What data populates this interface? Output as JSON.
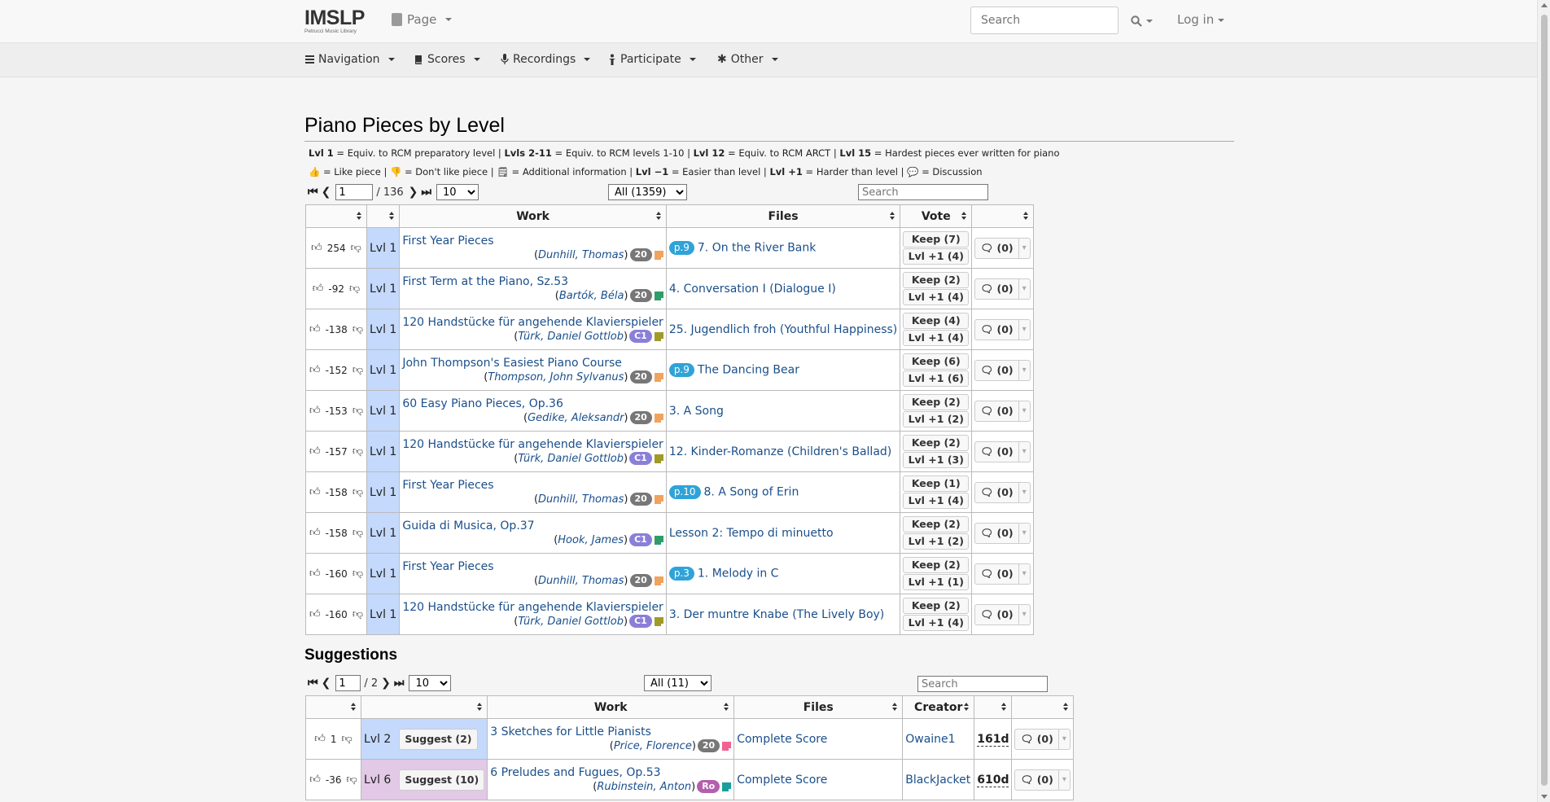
{
  "header": {
    "logo": "IMSLP",
    "logo_sub": "Petrucci Music Library",
    "page_menu": "Page",
    "search_placeholder": "Search",
    "login": "Log in"
  },
  "nav": [
    "Navigation",
    "Scores",
    "Recordings",
    "Participate",
    "Other"
  ],
  "title": "Piano Pieces by Level",
  "legend1": [
    {
      "b": "Lvl 1",
      "t": " = Equiv. to RCM preparatory level | "
    },
    {
      "b": "Lvls 2-11",
      "t": " = Equiv. to RCM levels 1-10 | "
    },
    {
      "b": "Lvl 12",
      "t": " = Equiv. to RCM ARCT | "
    },
    {
      "b": "Lvl 15",
      "t": " = Hardest pieces ever written for piano"
    }
  ],
  "legend2": [
    {
      "b": "",
      "t": "👍 = Like piece | 👎 = Don't like piece | 🗒 = Additional information | "
    },
    {
      "b": "Lvl −1",
      "t": " = Easier than level | "
    },
    {
      "b": "Lvl +1",
      "t": " = Harder than level | 💬 = Discussion"
    }
  ],
  "pager": {
    "page": "1",
    "total": "/ 136",
    "per_page": "10",
    "filter": "All (1359)",
    "search_placeholder": "Search"
  },
  "columns": [
    "",
    "",
    "Work",
    "Files",
    "Vote",
    ""
  ],
  "rows": [
    {
      "score": "254",
      "level": "Lvl 1",
      "work": "First Year Pieces",
      "composer": "Dunhill, Thomas",
      "badge": "20",
      "badge_type": "b20",
      "sq": "#f0a35c",
      "pbadge": "p.9",
      "file": "7. On the River Bank",
      "keep": "Keep (7)",
      "lvl": "Lvl +1 (4)",
      "disc": "(0)"
    },
    {
      "score": "-92",
      "level": "Lvl 1",
      "work": "First Term at the Piano, Sz.53",
      "composer": "Bartók, Béla",
      "badge": "20",
      "badge_type": "b20",
      "sq": "#2e9d6a",
      "pbadge": "",
      "file": "4. Conversation I (Dialogue I)",
      "keep": "Keep (2)",
      "lvl": "Lvl +1 (4)",
      "disc": "(0)"
    },
    {
      "score": "-138",
      "level": "Lvl 1",
      "work": "120 Handstücke für angehende Klavierspieler",
      "composer": "Türk, Daniel Gottlob",
      "badge": "C1",
      "badge_type": "bC1",
      "sq": "#a09a2a",
      "pbadge": "",
      "file": "25. Jugendlich froh (Youthful Happiness)",
      "keep": "Keep (4)",
      "lvl": "Lvl +1 (4)",
      "disc": "(0)"
    },
    {
      "score": "-152",
      "level": "Lvl 1",
      "work": "John Thompson's Easiest Piano Course",
      "composer": "Thompson, John Sylvanus",
      "badge": "20",
      "badge_type": "b20",
      "sq": "#f0a35c",
      "pbadge": "p.9",
      "file": "The Dancing Bear",
      "keep": "Keep (6)",
      "lvl": "Lvl +1 (6)",
      "disc": "(0)"
    },
    {
      "score": "-153",
      "level": "Lvl 1",
      "work": "60 Easy Piano Pieces, Op.36",
      "composer": "Gedike, Aleksandr",
      "badge": "20",
      "badge_type": "b20",
      "sq": "#f0a35c",
      "pbadge": "",
      "file": "3. A Song",
      "keep": "Keep (2)",
      "lvl": "Lvl +1 (2)",
      "disc": "(0)"
    },
    {
      "score": "-157",
      "level": "Lvl 1",
      "work": "120 Handstücke für angehende Klavierspieler",
      "composer": "Türk, Daniel Gottlob",
      "badge": "C1",
      "badge_type": "bC1",
      "sq": "#a09a2a",
      "pbadge": "",
      "file": "12. Kinder-Romanze (Children's Ballad)",
      "keep": "Keep (2)",
      "lvl": "Lvl +1 (3)",
      "disc": "(0)"
    },
    {
      "score": "-158",
      "level": "Lvl 1",
      "work": "First Year Pieces",
      "composer": "Dunhill, Thomas",
      "badge": "20",
      "badge_type": "b20",
      "sq": "#f0a35c",
      "pbadge": "p.10",
      "file": "8. A Song of Erin",
      "keep": "Keep (1)",
      "lvl": "Lvl +1 (4)",
      "disc": "(0)"
    },
    {
      "score": "-158",
      "level": "Lvl 1",
      "work": "Guida di Musica, Op.37",
      "composer": "Hook, James",
      "badge": "C1",
      "badge_type": "bC1",
      "sq": "#2e9d6a",
      "pbadge": "",
      "file": "Lesson 2: Tempo di minuetto",
      "keep": "Keep (2)",
      "lvl": "Lvl +1 (2)",
      "disc": "(0)"
    },
    {
      "score": "-160",
      "level": "Lvl 1",
      "work": "First Year Pieces",
      "composer": "Dunhill, Thomas",
      "badge": "20",
      "badge_type": "b20",
      "sq": "#f0a35c",
      "pbadge": "p.3",
      "file": "1. Melody in C",
      "keep": "Keep (2)",
      "lvl": "Lvl +1 (1)",
      "disc": "(0)"
    },
    {
      "score": "-160",
      "level": "Lvl 1",
      "work": "120 Handstücke für angehende Klavierspieler",
      "composer": "Türk, Daniel Gottlob",
      "badge": "C1",
      "badge_type": "bC1",
      "sq": "#a09a2a",
      "pbadge": "",
      "file": "3. Der muntre Knabe (The Lively Boy)",
      "keep": "Keep (2)",
      "lvl": "Lvl +1 (4)",
      "disc": "(0)"
    }
  ],
  "suggestions": {
    "title": "Suggestions",
    "pager": {
      "page": "1",
      "total": "/ 2",
      "per_page": "10",
      "filter": "All (11)",
      "search_placeholder": "Search"
    },
    "columns": [
      "",
      "",
      "Work",
      "Files",
      "Creator",
      "",
      ""
    ],
    "rows": [
      {
        "score": "1",
        "level": "Lvl 2",
        "suggest": "Suggest (2)",
        "work": "3 Sketches for Little Pianists",
        "composer": "Price, Florence",
        "badge": "20",
        "badge_type": "b20",
        "sq": "#f06292",
        "file": "Complete Score",
        "creator": "Owaine1",
        "age": "161d",
        "disc": "(0)",
        "lvlclass": "lvl"
      },
      {
        "score": "-36",
        "level": "Lvl 6",
        "suggest": "Suggest (10)",
        "work": "6 Preludes and Fugues, Op.53",
        "composer": "Rubinstein, Anton",
        "badge": "Ro",
        "badge_type": "bRo",
        "sq": "#1a9e9e",
        "file": "Complete Score",
        "creator": "BlackJacket",
        "age": "610d",
        "disc": "(0)",
        "lvlclass": "lvl lvl6"
      }
    ]
  }
}
